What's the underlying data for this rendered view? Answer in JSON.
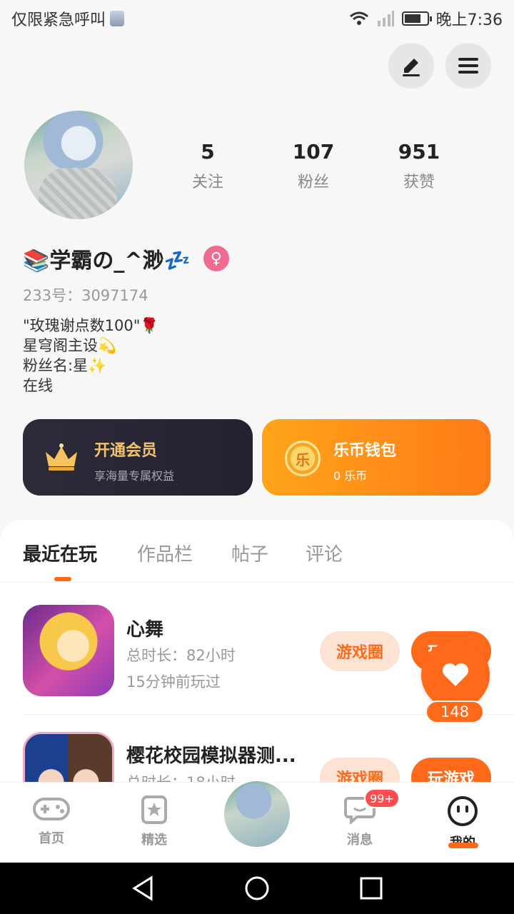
{
  "status_bar": {
    "carrier": "仅限紧急呼叫",
    "time": "晚上7:36"
  },
  "profile": {
    "nickname": "📚学霸の_^渺💤",
    "id_line": "233号：3097174",
    "bio": [
      "\"玫瑰谢点数100\"🌹",
      "星穹阁主设💫",
      "粉丝名:星✨",
      "在线"
    ],
    "gender_symbol": "♀"
  },
  "stats": [
    {
      "value": "5",
      "label": "关注"
    },
    {
      "value": "107",
      "label": "粉丝"
    },
    {
      "value": "951",
      "label": "获赞"
    }
  ],
  "vip": {
    "title": "开通会员",
    "subtitle": "享海量专属权益"
  },
  "wallet": {
    "icon_text": "乐",
    "title": "乐币钱包",
    "subtitle": "0 乐币"
  },
  "tabs": [
    "最近在玩",
    "作品栏",
    "帖子",
    "评论"
  ],
  "games": [
    {
      "title": "心舞",
      "duration": "总时长：82小时",
      "last_played": "15分钟前玩过",
      "circle_label": "游戏圈",
      "play_label": "玩游戏"
    },
    {
      "title": "樱花校园模拟器测...",
      "duration": "总时长：18小时",
      "circle_label": "游戏圈",
      "play_label": "玩游戏"
    }
  ],
  "like": {
    "count": "148"
  },
  "bottom_nav": {
    "home": "首页",
    "featured": "精选",
    "messages": "消息",
    "messages_badge": "99+",
    "mine": "我的"
  },
  "colors": {
    "accent": "#ff6a1a",
    "vip_gold": "#f3c46a",
    "gender_pink": "#f06b8f"
  }
}
